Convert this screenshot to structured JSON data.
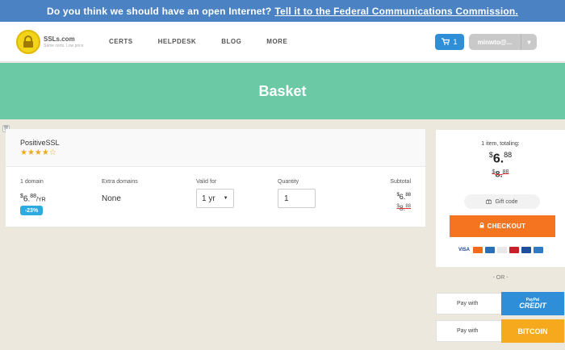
{
  "banner": {
    "text": "Do you think we should have an open Internet?",
    "link": "Tell it to the Federal Communications Commission."
  },
  "header": {
    "logo_name": "SSLs.com",
    "logo_tagline": "Same certs. Low price",
    "nav": [
      "CERTS",
      "HELPDESK",
      "BLOG",
      "MORE"
    ],
    "cart_count": "1",
    "user": "minwto@..."
  },
  "hero": {
    "title": "Basket"
  },
  "product": {
    "name": "PositiveSSL",
    "rating": "★★★★☆",
    "col_domains": "1 domain",
    "col_extra": "Extra domains",
    "col_valid": "Valid for",
    "col_qty": "Quantity",
    "col_subtotal": "Subtotal",
    "price_int": "6.",
    "price_cents": "88",
    "price_period": "/YR",
    "discount": "-23%",
    "extra_value": "None",
    "valid_value": "1 yr",
    "qty_value": "1",
    "subtotal_int": "6.",
    "subtotal_cents": "88",
    "old_int": "8.",
    "old_cents": "88",
    "currency": "$"
  },
  "summary": {
    "label": "1 item, totaling:",
    "total_int": "6.",
    "total_cents": "88",
    "old_int": "8.",
    "old_cents": "88",
    "currency": "$",
    "gift": "Gift code",
    "checkout": "CHECKOUT",
    "cards": [
      "VISA",
      "MC",
      "AMEX",
      "DISC",
      "DIN",
      "JCB",
      "PP"
    ]
  },
  "payments": {
    "or": "- OR -",
    "pay_with": "Pay with",
    "paypal": "PayPal",
    "paypal_credit": "CREDIT",
    "bitcoin": "BITCOIN"
  },
  "colors": {
    "banner": "#4a82c4",
    "hero": "#6cc9a6",
    "checkout": "#f5741f",
    "cart": "#2e8fd8",
    "bitcoin": "#f7a91e"
  }
}
